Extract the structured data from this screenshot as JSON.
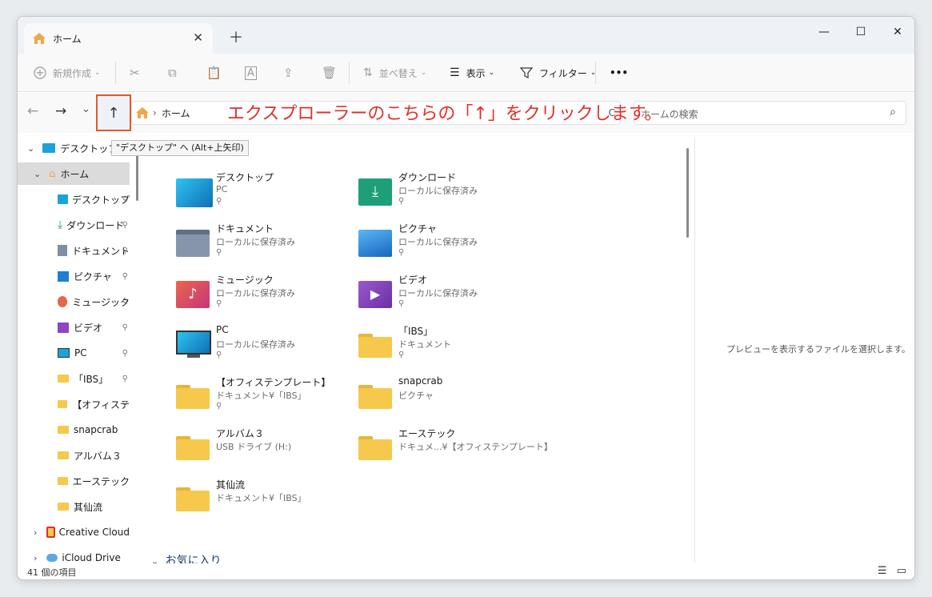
{
  "window": {
    "tab_title": "ホーム",
    "tab_close": "✕",
    "new_tab": "＋",
    "minimize": "—",
    "maximize": "☐",
    "close": "✕"
  },
  "toolbar": {
    "new_label": "新規作成",
    "sort_label": "並べ替え",
    "view_label": "表示",
    "filter_label": "フィルター",
    "more_label": "•••"
  },
  "address": {
    "back": "←",
    "forward": "→",
    "recent": "⌄",
    "up": "↑",
    "path_sep": "›",
    "path": "ホーム",
    "refresh": "C",
    "search_placeholder": "ホームの検索"
  },
  "annotation": "エクスプローラーのこちらの「↑」をクリックします。",
  "tooltip": "\"デスクトップ\" へ (Alt+上矢印)",
  "sidebar": {
    "items": [
      {
        "label": "デスクトップ",
        "pinned": false
      },
      {
        "label": "ホーム",
        "pinned": false
      },
      {
        "label": "デスクトップ",
        "pinned": true
      },
      {
        "label": "ダウンロード",
        "pinned": true
      },
      {
        "label": "ドキュメント",
        "pinned": true
      },
      {
        "label": "ピクチャ",
        "pinned": true
      },
      {
        "label": "ミュージック",
        "pinned": true
      },
      {
        "label": "ビデオ",
        "pinned": true
      },
      {
        "label": "PC",
        "pinned": true
      },
      {
        "label": "「IBS」",
        "pinned": true
      },
      {
        "label": "【オフィステ",
        "pinned": true
      },
      {
        "label": "snapcrab",
        "pinned": false
      },
      {
        "label": "アルバム３",
        "pinned": false
      },
      {
        "label": "エーステック",
        "pinned": false
      },
      {
        "label": "其仙流",
        "pinned": false
      },
      {
        "label": "Creative Cloud",
        "pinned": false
      },
      {
        "label": "iCloud Drive",
        "pinned": false
      }
    ],
    "pin_glyph": "📌"
  },
  "quick_access": [
    {
      "name": "デスクトップ",
      "sub": "PC",
      "pinned": true,
      "icon": "desktop-icon"
    },
    {
      "name": "ダウンロード",
      "sub": "ローカルに保存済み",
      "pinned": true,
      "icon": "download-icon"
    },
    {
      "name": "ドキュメント",
      "sub": "ローカルに保存済み",
      "pinned": true,
      "icon": "documents-icon"
    },
    {
      "name": "ピクチャ",
      "sub": "ローカルに保存済み",
      "pinned": true,
      "icon": "pictures-icon"
    },
    {
      "name": "ミュージック",
      "sub": "ローカルに保存済み",
      "pinned": true,
      "icon": "music-icon"
    },
    {
      "name": "ビデオ",
      "sub": "ローカルに保存済み",
      "pinned": true,
      "icon": "videos-icon"
    },
    {
      "name": "PC",
      "sub": "ローカルに保存済み",
      "pinned": true,
      "icon": "pc-icon"
    },
    {
      "name": "「IBS」",
      "sub": "ドキュメント",
      "pinned": true,
      "icon": "folder-icon"
    },
    {
      "name": "【オフィステンプレート】",
      "sub": "ドキュメント¥「IBS」",
      "pinned": true,
      "icon": "folder-icon"
    },
    {
      "name": "snapcrab",
      "sub": "ピクチャ",
      "pinned": false,
      "icon": "folder-icon"
    },
    {
      "name": "アルバム３",
      "sub": "USB ドライブ (H:)",
      "pinned": false,
      "icon": "folder-icon"
    },
    {
      "name": "エーステック",
      "sub": "ドキュメ...¥【オフィステンプレート】",
      "pinned": false,
      "icon": "folder-icon"
    },
    {
      "name": "其仙流",
      "sub": "ドキュメント¥「IBS」",
      "pinned": false,
      "icon": "folder-icon"
    }
  ],
  "favorites_header": "お気に入り",
  "preview_text": "プレビューを表示するファイルを選択します。",
  "status": {
    "item_count": "41 個の項目"
  }
}
